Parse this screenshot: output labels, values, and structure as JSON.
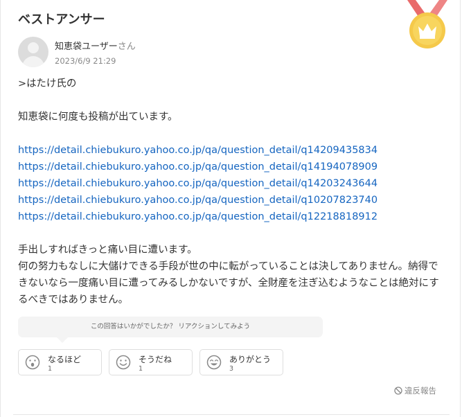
{
  "section_title": "ベストアンサー",
  "answer": {
    "user_name": "知恵袋ユーザー",
    "user_suffix": "さん",
    "date": "2023/6/9 21:29",
    "intro": ">はたけ氏の",
    "line2": "知恵袋に何度も投稿が出ています。",
    "links": [
      "https://detail.chiebukuro.yahoo.co.jp/qa/question_detail/q14209435834",
      "https://detail.chiebukuro.yahoo.co.jp/qa/question_detail/q14194078909",
      "https://detail.chiebukuro.yahoo.co.jp/qa/question_detail/q14203243644",
      "https://detail.chiebukuro.yahoo.co.jp/qa/question_detail/q10207823740",
      "https://detail.chiebukuro.yahoo.co.jp/qa/question_detail/q12218818912"
    ],
    "para1": "手出しすればきっと痛い目に遭います。",
    "para2": "何の努力もなしに大儲けできる手段が世の中に転がっていることは決してありません。納得できないなら一度痛い目に遭ってみるしかないですが、全財産を注ぎ込むようなことは絶対にするべきではありません。"
  },
  "reaction_prompt": "この回答はいかがでしたか？ リアクションしてみよう",
  "reactions": [
    {
      "label": "なるほど",
      "count": "1",
      "icon": "surprised-face-icon"
    },
    {
      "label": "そうだね",
      "count": "1",
      "icon": "smile-face-icon"
    },
    {
      "label": "ありがとう",
      "count": "3",
      "icon": "happy-face-icon"
    }
  ],
  "report_label": "違反報告",
  "colors": {
    "link": "#1565c0",
    "medal_gold": "#f5c94a",
    "ribbon": "#e96b6b"
  }
}
